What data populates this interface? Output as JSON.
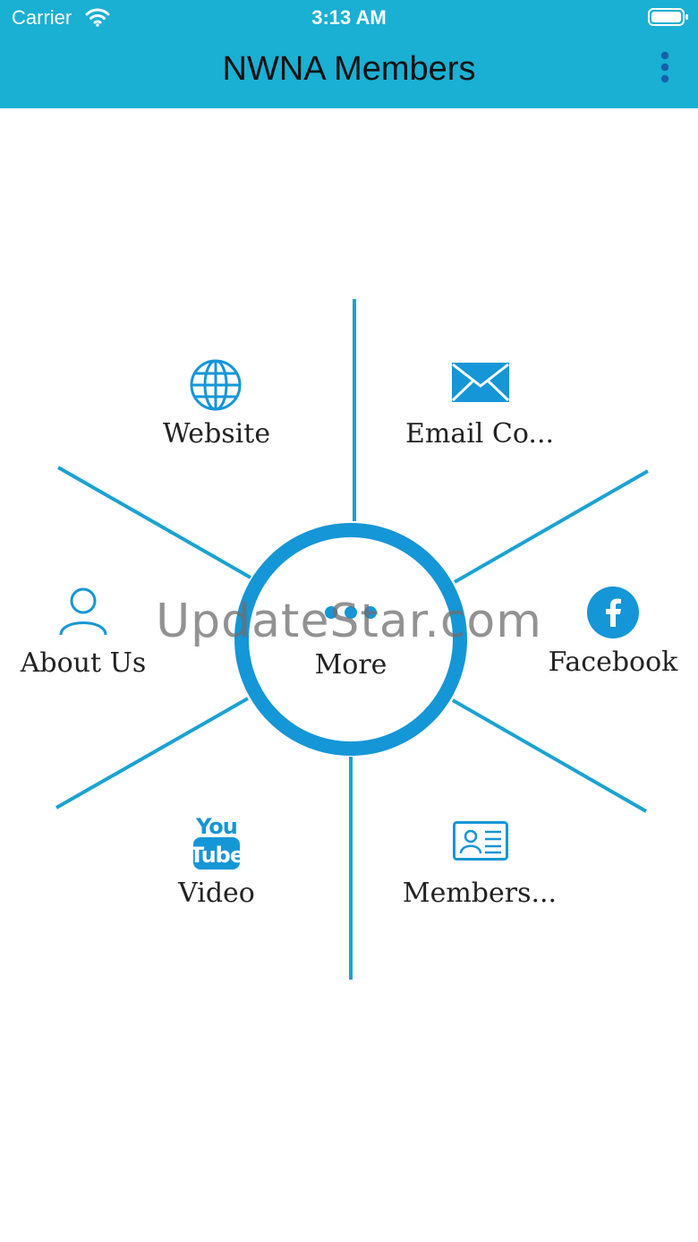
{
  "status_bar": {
    "carrier": "Carrier",
    "time": "3:13 AM"
  },
  "header": {
    "title": "NWNA Members",
    "menu_icon": "more-vertical-icon"
  },
  "colors": {
    "header_bg": "#1ab0d3",
    "accent": "#1596d6",
    "text": "#222222"
  },
  "menu": {
    "center": {
      "label": "More",
      "icon": "dots-icon"
    },
    "items": [
      {
        "label": "Website",
        "icon": "globe-icon"
      },
      {
        "label": "Email Co...",
        "icon": "envelope-icon"
      },
      {
        "label": "About Us",
        "icon": "person-icon"
      },
      {
        "label": "Facebook",
        "icon": "facebook-icon"
      },
      {
        "label": "Video",
        "icon": "youtube-icon"
      },
      {
        "label": "Members...",
        "icon": "id-card-icon"
      }
    ]
  },
  "watermark": "UpdateStar.com"
}
